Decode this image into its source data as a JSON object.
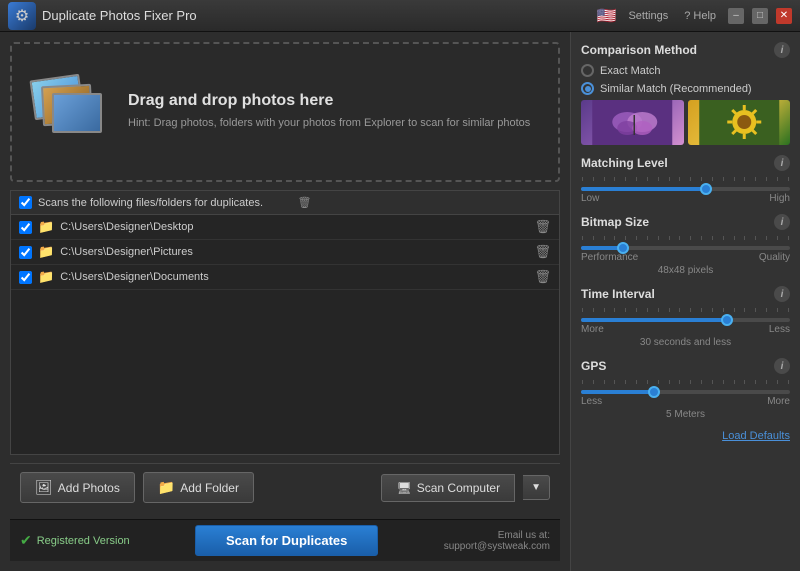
{
  "titleBar": {
    "title": "Duplicate Photos Fixer Pro",
    "settingsBtn": "Settings",
    "helpBtn": "? Help"
  },
  "dropZone": {
    "heading": "Drag and drop photos here",
    "hint": "Hint: Drag photos, folders with your photos from Explorer to scan for similar photos"
  },
  "folderList": {
    "headerText": "Scans the following files/folders for duplicates.",
    "folders": [
      {
        "path": "C:\\Users\\Designer\\Desktop"
      },
      {
        "path": "C:\\Users\\Designer\\Pictures"
      },
      {
        "path": "C:\\Users\\Designer\\Documents"
      }
    ]
  },
  "buttons": {
    "addPhotos": "Add Photos",
    "addFolder": "Add Folder",
    "scanComputer": "Scan Computer",
    "scanForDuplicates": "Scan for Duplicates"
  },
  "statusBar": {
    "registered": "Registered Version",
    "emailLabel": "Email us at:",
    "emailAddress": "support@systweak.com"
  },
  "rightPanel": {
    "comparisonMethod": {
      "title": "Comparison Method",
      "exactMatch": "Exact Match",
      "similarMatch": "Similar Match (Recommended)"
    },
    "matchingLevel": {
      "title": "Matching Level",
      "low": "Low",
      "high": "High",
      "thumbPosition": 60
    },
    "bitmapSize": {
      "title": "Bitmap Size",
      "performance": "Performance",
      "quality": "Quality",
      "centerLabel": "48x48 pixels",
      "thumbPosition": 20
    },
    "timeInterval": {
      "title": "Time Interval",
      "more": "More",
      "less": "Less",
      "centerLabel": "30 seconds and less",
      "thumbPosition": 70
    },
    "gps": {
      "title": "GPS",
      "less": "Less",
      "more": "More",
      "centerLabel": "5 Meters",
      "thumbPosition": 35
    },
    "loadDefaults": "Load Defaults"
  }
}
